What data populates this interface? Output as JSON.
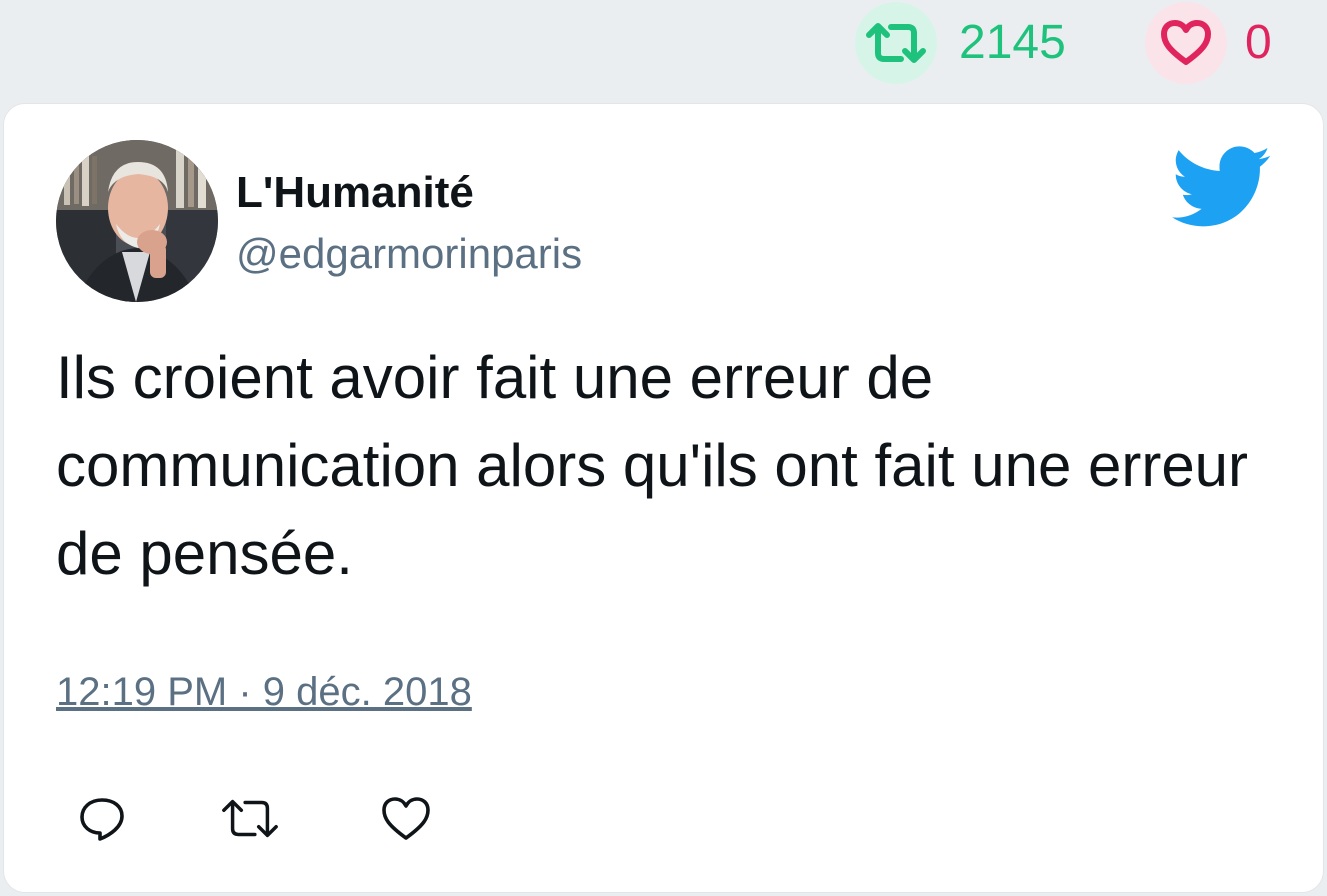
{
  "stats": {
    "retweet_count": "2145",
    "like_count": "0",
    "retweet_icon": "retweet-icon",
    "like_icon": "heart-icon"
  },
  "tweet": {
    "author_name": "L'Humanité",
    "author_handle": "@edgarmorinparis",
    "text": "Ils croient avoir fait une erreur de communication alors qu'ils ont fait une erreur de pensée.",
    "timestamp": "12:19 PM · 9 déc. 2018",
    "avatar_icon": "avatar-photo",
    "brand_icon": "twitter-bird-icon",
    "actions": [
      "reply-icon",
      "retweet-icon",
      "heart-icon"
    ]
  },
  "colors": {
    "retweet_green": "#1fc27d",
    "like_red": "#e0245e",
    "twitter_blue": "#1da1f2",
    "secondary_text": "#5b7083"
  }
}
